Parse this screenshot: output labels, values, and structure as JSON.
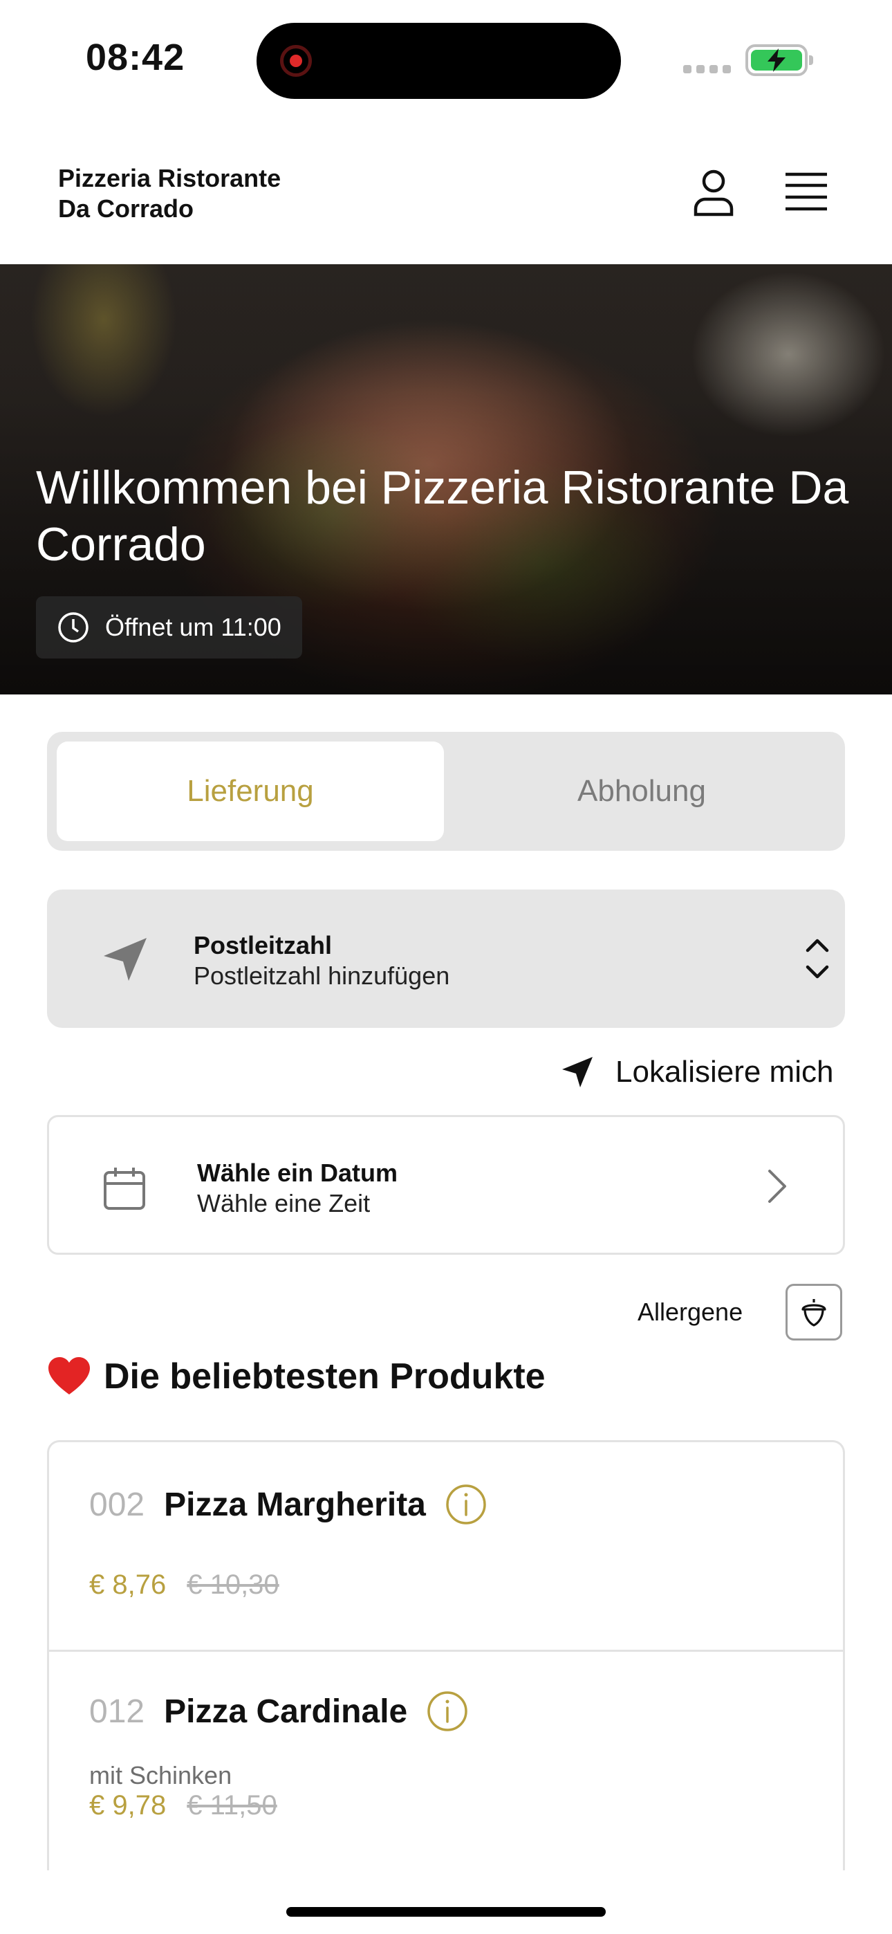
{
  "status_bar": {
    "time": "08:42"
  },
  "header": {
    "restaurant_name_line1": "Pizzeria Ristorante",
    "restaurant_name_line2": "Da Corrado"
  },
  "hero": {
    "title": "Willkommen bei Pizzeria Ristorante Da Corrado",
    "opening_info": "Öffnet um 11:00"
  },
  "order_mode": {
    "tabs": [
      {
        "label": "Lieferung",
        "active": true
      },
      {
        "label": "Abholung",
        "active": false
      }
    ]
  },
  "postcode": {
    "title": "Postleitzahl",
    "placeholder": "Postleitzahl hinzufügen"
  },
  "locate_label": "Lokalisiere mich",
  "date_picker": {
    "title": "Wähle ein Datum",
    "subtitle": "Wähle eine Zeit"
  },
  "allergens_label": "Allergene",
  "popular": {
    "title": "Die beliebtesten Produkte",
    "products": [
      {
        "number": "002",
        "name": "Pizza Margherita",
        "description": "",
        "price": "€ 8,76",
        "old_price": "€ 10,30"
      },
      {
        "number": "012",
        "name": "Pizza Cardinale",
        "description": "mit Schinken",
        "price": "€ 9,78",
        "old_price": "€ 11,50"
      }
    ]
  },
  "colors": {
    "accent": "#b8a040",
    "panel": "#e6e6e6",
    "border": "#e2e2e2",
    "muted": "#b5b5b5"
  }
}
